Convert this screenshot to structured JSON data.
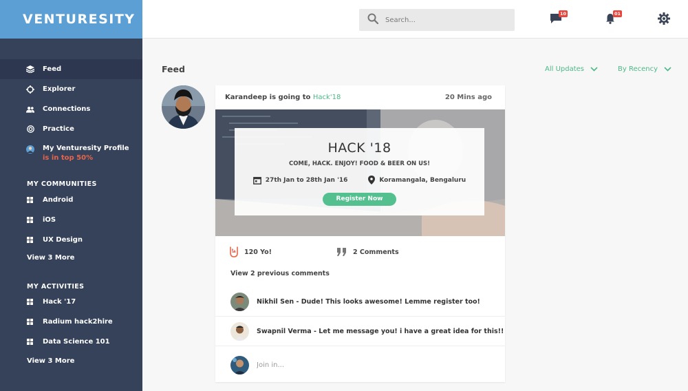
{
  "brand": "VENTURESITY",
  "colors": {
    "accent": "#4db888",
    "sidebar": "#35425a",
    "brand_bg": "#5c9fd5",
    "badge": "#e8453c",
    "highlight_red": "#e8654c"
  },
  "nav": [
    {
      "label": "Feed",
      "icon": "stack-icon",
      "active": true
    },
    {
      "label": "Explorer",
      "icon": "crosshair-icon"
    },
    {
      "label": "Connections",
      "icon": "people-icon"
    },
    {
      "label": "Practice",
      "icon": "target-icon"
    }
  ],
  "profile": {
    "label": "My Venturesity Profile",
    "rank": "is in top 50%",
    "icon": "profile-icon"
  },
  "communities": {
    "title": "MY COMMUNITIES",
    "items": [
      "Android",
      "iOS",
      "UX Design"
    ],
    "more": "View 3 More"
  },
  "activities": {
    "title": "MY ACTIVITIES",
    "items": [
      "Hack '17",
      "Radium hack2hire",
      "Data Science 101"
    ],
    "more": "View 3 More"
  },
  "search": {
    "placeholder": "Search..."
  },
  "header": {
    "messages_count": "10",
    "notifications_count": "01"
  },
  "feed": {
    "title": "Feed",
    "filter_updates": "All Updates",
    "filter_sort": "By Recency"
  },
  "post": {
    "author": "Karandeep",
    "action": " is going to ",
    "event_link": "Hack'18",
    "time": "20 Mins ago",
    "event": {
      "title": "HACK '18",
      "subtitle": "COME, HACK. ENJOY! FOOD & BEER ON US!",
      "dates": "27th Jan to 28th Jan '16",
      "location": "Koramangala, Bengaluru",
      "cta": "Register Now"
    },
    "yo_count": "120 Yo!",
    "comments_count": "2 Comments",
    "view_previous": "View 2 previous comments",
    "comments": [
      {
        "text": "Nikhil Sen - Dude! This looks awesome! Lemme register too!"
      },
      {
        "text": "Swapnil Verma - Let me message you! i have a great idea for this!!"
      }
    ],
    "join_placeholder": "Join in..."
  }
}
